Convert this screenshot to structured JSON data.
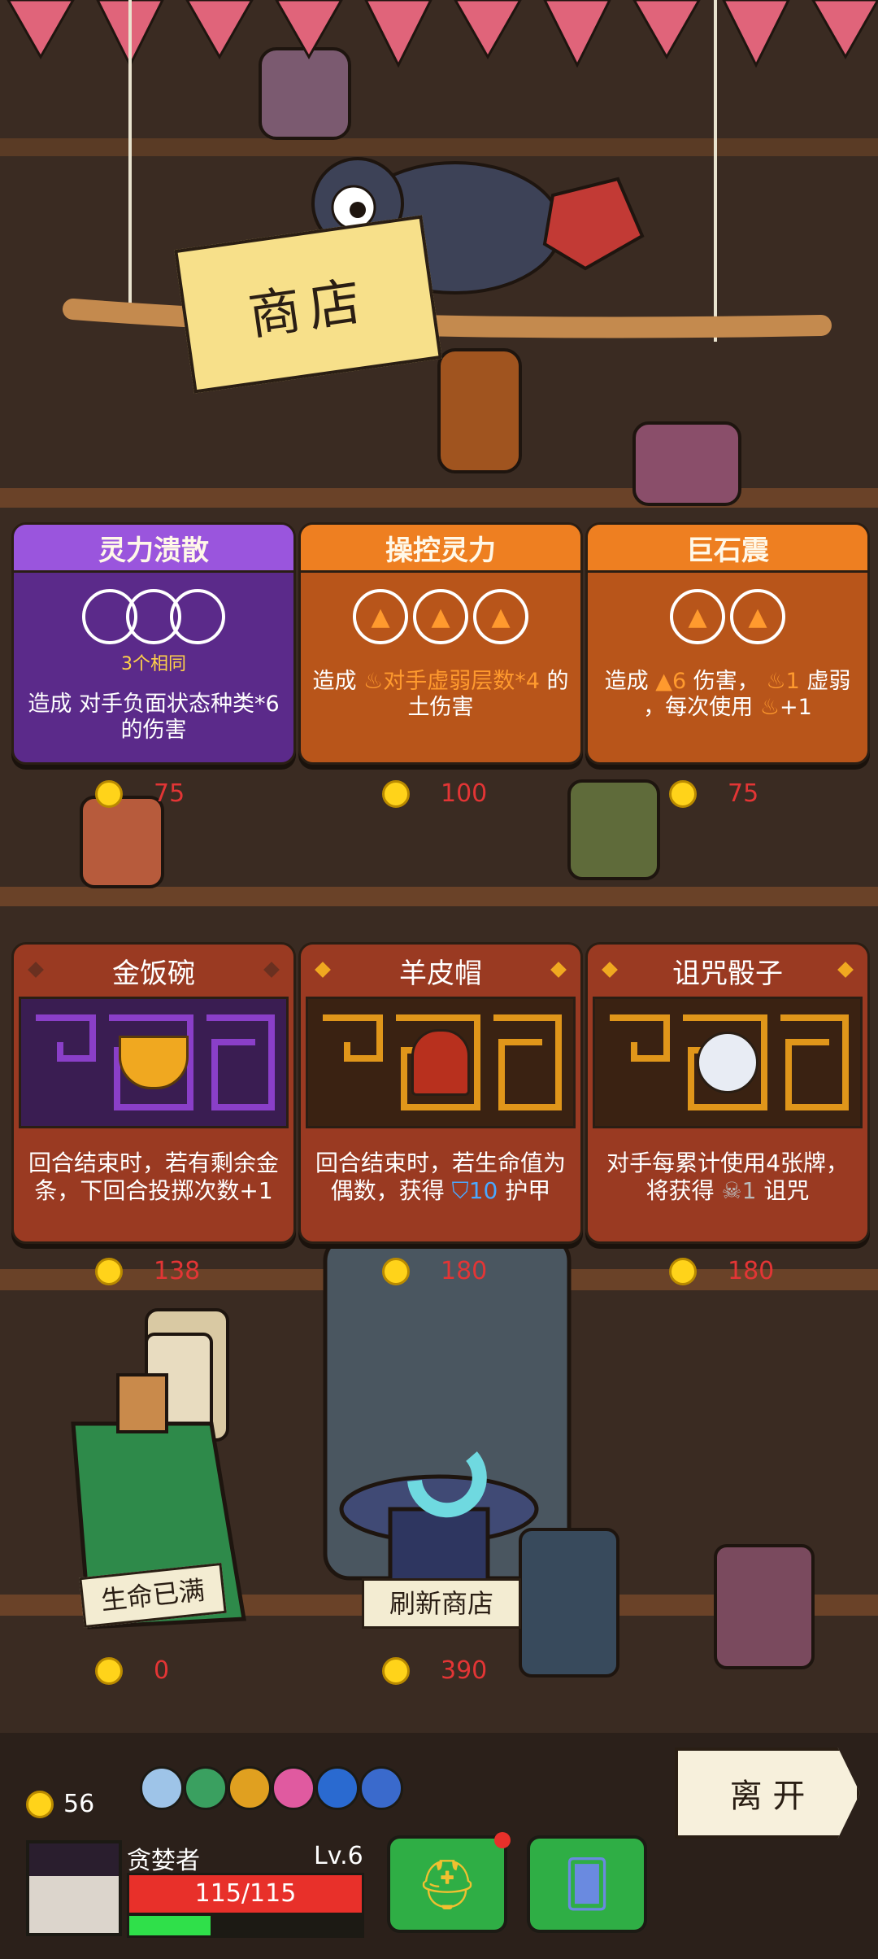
{
  "shop": {
    "title": "商店"
  },
  "skills": [
    {
      "name": "灵力溃散",
      "sub": "3个相同",
      "desc": "造成 对手负面状态种类*6 的伤害",
      "price": "75",
      "color": "#5b2a8a",
      "head": "#9a55dd"
    },
    {
      "name": "操控灵力",
      "desc_a": "造成",
      "desc_b": "对手虚弱层数*4",
      "desc_c": "的",
      "desc_d": "土伤害",
      "price": "100",
      "color": "#b8551a",
      "head": "#ee7f21"
    },
    {
      "name": "巨石震",
      "desc_a": "造成",
      "desc_b": "6",
      "desc_c": "伤害，",
      "desc_d": "1",
      "desc_e": "虚弱",
      "desc_f": "，每次使用",
      "desc_g": "+1",
      "price": "75",
      "color": "#b8551a",
      "head": "#ee7f21"
    }
  ],
  "relics": [
    {
      "name": "金饭碗",
      "desc": "回合结束时，若有剩余金条，下回合投掷次数+1",
      "price": "138"
    },
    {
      "name": "羊皮帽",
      "desc_a": "回合结束时，若生命值为偶数，获得",
      "desc_b": "10",
      "desc_c": "护甲",
      "price": "180"
    },
    {
      "name": "诅咒骰子",
      "desc_a": "对手每累计使用4张牌，将获得",
      "desc_b": "1",
      "desc_c": "诅咒",
      "price": "180"
    }
  ],
  "services": [
    {
      "label": "生命已满",
      "price": "0"
    },
    {
      "label": "刷新商店",
      "price": "390"
    }
  ],
  "leave": "离 开",
  "player": {
    "gold": "56",
    "name": "贪婪者",
    "level": "Lv.6",
    "hp": "115/115",
    "hp_fraction": 1.0,
    "xp_fraction": 0.35
  },
  "colors": {
    "accent_orange": "#ee7f21",
    "accent_purple": "#9a55dd",
    "price_red": "#e33535",
    "coin": "#ffd31a",
    "button_green": "#2fae45"
  }
}
